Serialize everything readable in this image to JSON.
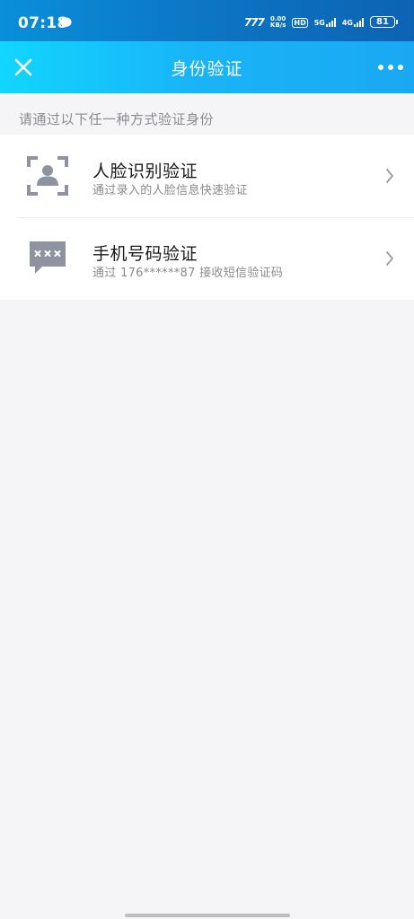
{
  "status_bar": {
    "time": "07:18",
    "carrier_logo": "777",
    "speed_value": "0.00",
    "speed_unit": "KB/s",
    "hd_label": "HD",
    "network_1": "5G",
    "network_2": "4G",
    "battery": "81"
  },
  "nav": {
    "title": "身份验证",
    "close_icon": "close-icon",
    "more_icon": "more-icon"
  },
  "hint": "请通过以下任一种方式验证身份",
  "options": [
    {
      "title": "人脸识别验证",
      "desc": "通过录入的人脸信息快速验证",
      "icon": "face-scan-icon"
    },
    {
      "title": "手机号码验证",
      "desc": "通过 176******87 接收短信验证码",
      "icon": "sms-icon"
    }
  ],
  "colors": {
    "nav_gradient_start": "#11d6ff",
    "nav_gradient_end": "#1aa8f3",
    "icon_gray": "#8e939f",
    "background": "#f5f5f8"
  }
}
